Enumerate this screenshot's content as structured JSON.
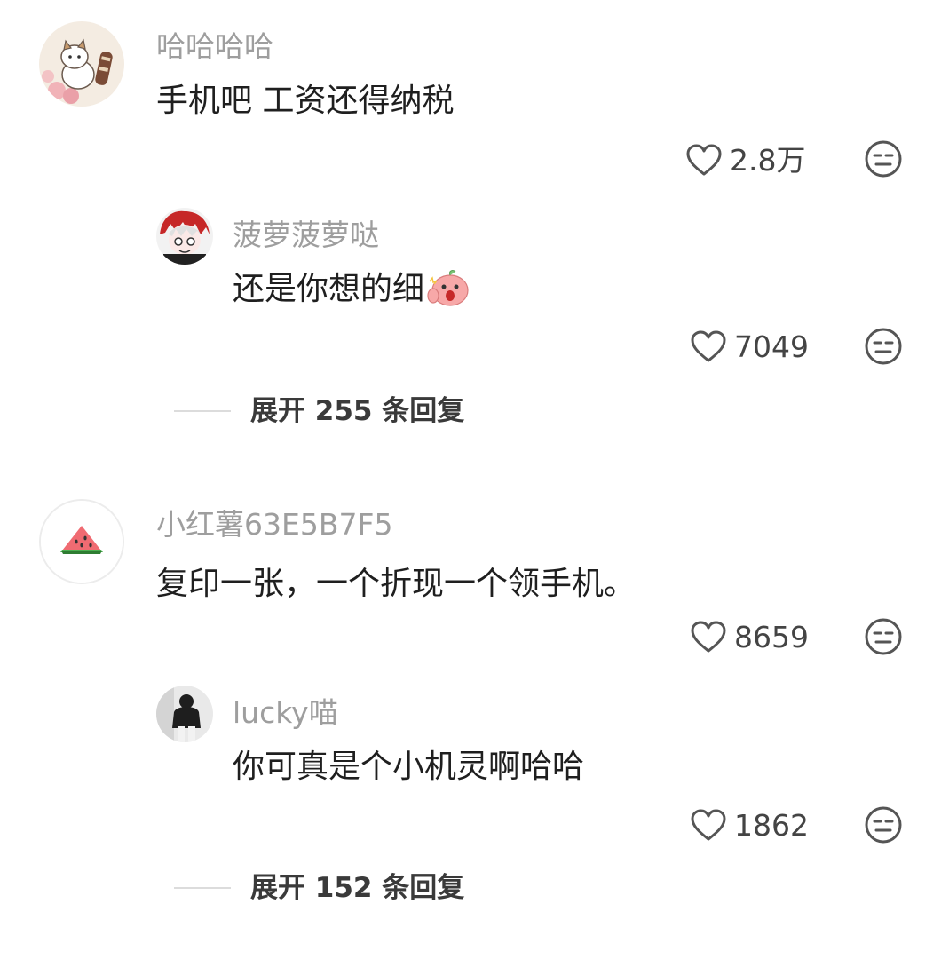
{
  "threads": [
    {
      "comment": {
        "user": "哈哈哈哈",
        "avatar_icon": "cartoon-cat-avatar",
        "text": "手机吧 工资还得纳税",
        "likes": "2.8万"
      },
      "reply": {
        "user": "菠萝菠萝哒",
        "avatar_icon": "anime-character-avatar",
        "text": "还是你想的细",
        "emoji_icon": "pink-shocked-emoji",
        "likes": "7049"
      },
      "expand_label": "展开 255 条回复"
    },
    {
      "comment": {
        "user": "小红薯63E5B7F5",
        "avatar_icon": "watermelon-avatar",
        "text": "复印一张，一个折现一个领手机。",
        "likes": "8659"
      },
      "reply": {
        "user": "lucky喵",
        "avatar_icon": "person-photo-avatar",
        "text": "你可真是个小机灵啊哈哈",
        "likes": "1862"
      },
      "expand_label": "展开 152 条回复"
    }
  ],
  "icons": {
    "like": "heart-icon",
    "dislike": "unamused-face-icon"
  },
  "colors": {
    "username": "#9e9e9e",
    "text": "#1f1f1f",
    "icon": "#555555"
  }
}
